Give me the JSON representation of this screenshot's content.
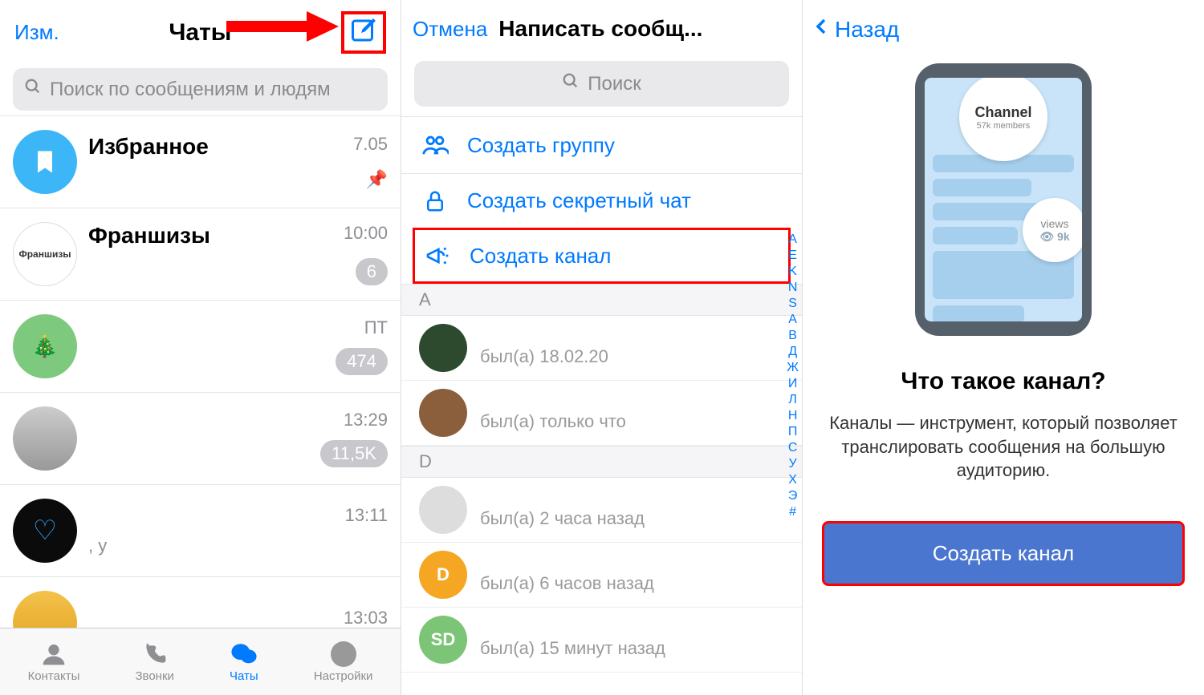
{
  "p1": {
    "edit": "Изм.",
    "title": "Чаты",
    "search_placeholder": "Поиск по сообщениям и людям",
    "chats": [
      {
        "name": "Избранное",
        "time": "7.05",
        "badge": "",
        "pinned": true,
        "msg": ""
      },
      {
        "name": "Франшизы",
        "time": "10:00",
        "badge": "6",
        "pinned": false,
        "msg": ""
      },
      {
        "name": "",
        "time": "ПТ",
        "badge": "474",
        "pinned": false,
        "msg": ""
      },
      {
        "name": "",
        "time": "13:29",
        "badge": "11,5K",
        "pinned": false,
        "msg": ""
      },
      {
        "name": "",
        "time": "13:11",
        "badge": "",
        "pinned": false,
        "msg": ", у"
      },
      {
        "name": "",
        "time": "13:03",
        "badge": "",
        "pinned": false,
        "msg": ""
      }
    ],
    "tabs": {
      "contacts": "Контакты",
      "calls": "Звонки",
      "chats": "Чаты",
      "settings": "Настройки"
    }
  },
  "p2": {
    "cancel": "Отмена",
    "title": "Написать сообщ...",
    "search_placeholder": "Поиск",
    "actions": {
      "group": "Создать группу",
      "secret": "Создать секретный чат",
      "channel": "Создать канал"
    },
    "sections": [
      {
        "letter": "A",
        "contacts": [
          {
            "status": "был(а) 18.02.20",
            "color": "#2e4a2e"
          },
          {
            "status": "был(а) только что",
            "color": "#8b5e3c"
          }
        ]
      },
      {
        "letter": "D",
        "contacts": [
          {
            "status": "был(а) 2 часа назад",
            "color": "#ddd"
          },
          {
            "status": "был(а) 6 часов назад",
            "color": "#f5a623",
            "initial": "D"
          },
          {
            "status": "был(а) 15 минут назад",
            "color": "#7cc576",
            "initial": "SD"
          }
        ]
      }
    ],
    "index": [
      "A",
      "E",
      "K",
      "N",
      "S",
      "А",
      "В",
      "Д",
      "Ж",
      "И",
      "Л",
      "Н",
      "П",
      "С",
      "У",
      "Х",
      "Э",
      "#"
    ]
  },
  "p3": {
    "back": "Назад",
    "illus": {
      "channel": "Channel",
      "members": "57k members",
      "views_label": "views",
      "views_count": "9k"
    },
    "question": "Что такое канал?",
    "desc": "Каналы — инструмент, который позволяет транслировать сообщения на большую аудиторию.",
    "button": "Создать канал"
  }
}
